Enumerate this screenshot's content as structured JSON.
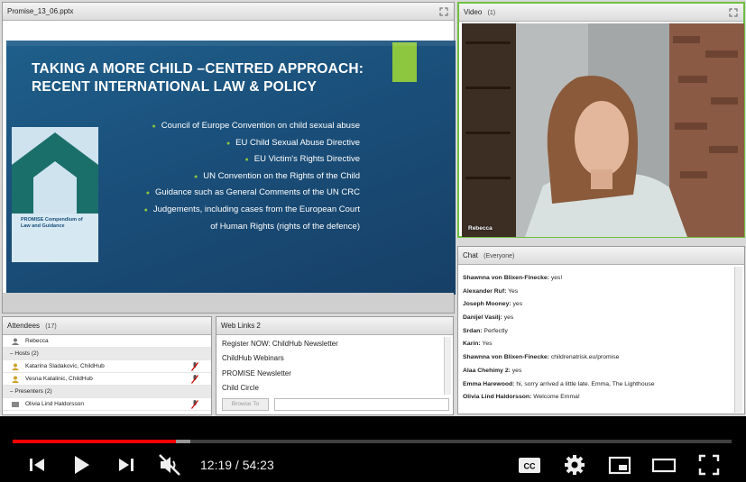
{
  "share": {
    "filename": "Promise_13_06.pptx",
    "slide": {
      "title": "TAKING A MORE CHILD –CENTRED APPROACH: RECENT INTERNATIONAL LAW & POLICY",
      "bullets": [
        "Council of Europe Convention on child sexual abuse",
        "EU Child Sexual Abuse Directive",
        "EU Victim's Rights Directive",
        "UN Convention on the Rights of the Child",
        "Guidance such as General Comments of the UN CRC",
        "Judgements, including cases from the European Court",
        "of Human Rights  (rights of the defence)"
      ],
      "book_text": "PROMISE Compendium of Law and Guidance"
    }
  },
  "video": {
    "title": "Video",
    "count": "(1)",
    "speaker": "Rebecca"
  },
  "chat": {
    "title": "Chat",
    "scope": "(Everyone)",
    "messages": [
      {
        "sender": "Shawnna von Blixen-Finecke:",
        "text": "yes!"
      },
      {
        "sender": "Alexander Ruf:",
        "text": "Yes"
      },
      {
        "sender": "Joseph Mooney:",
        "text": "yes"
      },
      {
        "sender": "Danijel Vasilj:",
        "text": "yes"
      },
      {
        "sender": "Srdan:",
        "text": "Perfectly"
      },
      {
        "sender": "Karin:",
        "text": "Yes"
      },
      {
        "sender": "Shawnna von Blixen-Finecke:",
        "text": "childrenatrisk.eu/promise"
      },
      {
        "sender": "Alaa Chehimy 2:",
        "text": "yes"
      },
      {
        "sender": "Emma Harewood:",
        "text": "hi, sorry arrived a little late. Emma, The Lighthouse"
      },
      {
        "sender": "Olivia Lind Haldorsson:",
        "text": "Welcome Emma!"
      }
    ]
  },
  "attendees": {
    "title": "Attendees",
    "count": "(17)",
    "me": "Rebecca",
    "hosts_label": "Hosts (2)",
    "hosts": [
      "Katarina Sladakovic, ChildHub",
      "Vesna Katalinic, ChildHub"
    ],
    "presenters_label": "Presenters (2)",
    "presenters": [
      "Olivia Lind Haldorsson"
    ]
  },
  "weblinks": {
    "title": "Web Links 2",
    "links": [
      "Register NOW: ChildHub Newsletter",
      "ChildHub Webinars",
      "PROMISE Newsletter",
      "Child Circle"
    ],
    "browse_label": "Browse To"
  },
  "player": {
    "current_time": "12:19",
    "separator": " / ",
    "duration": "54:23",
    "played_fraction": 0.2265,
    "buffered_fraction": 0.247,
    "icons": [
      "prev-icon",
      "play-icon",
      "next-icon",
      "mute-icon",
      "subtitles-icon",
      "settings-icon",
      "miniplayer-icon",
      "theater-icon",
      "fullscreen-icon"
    ]
  }
}
